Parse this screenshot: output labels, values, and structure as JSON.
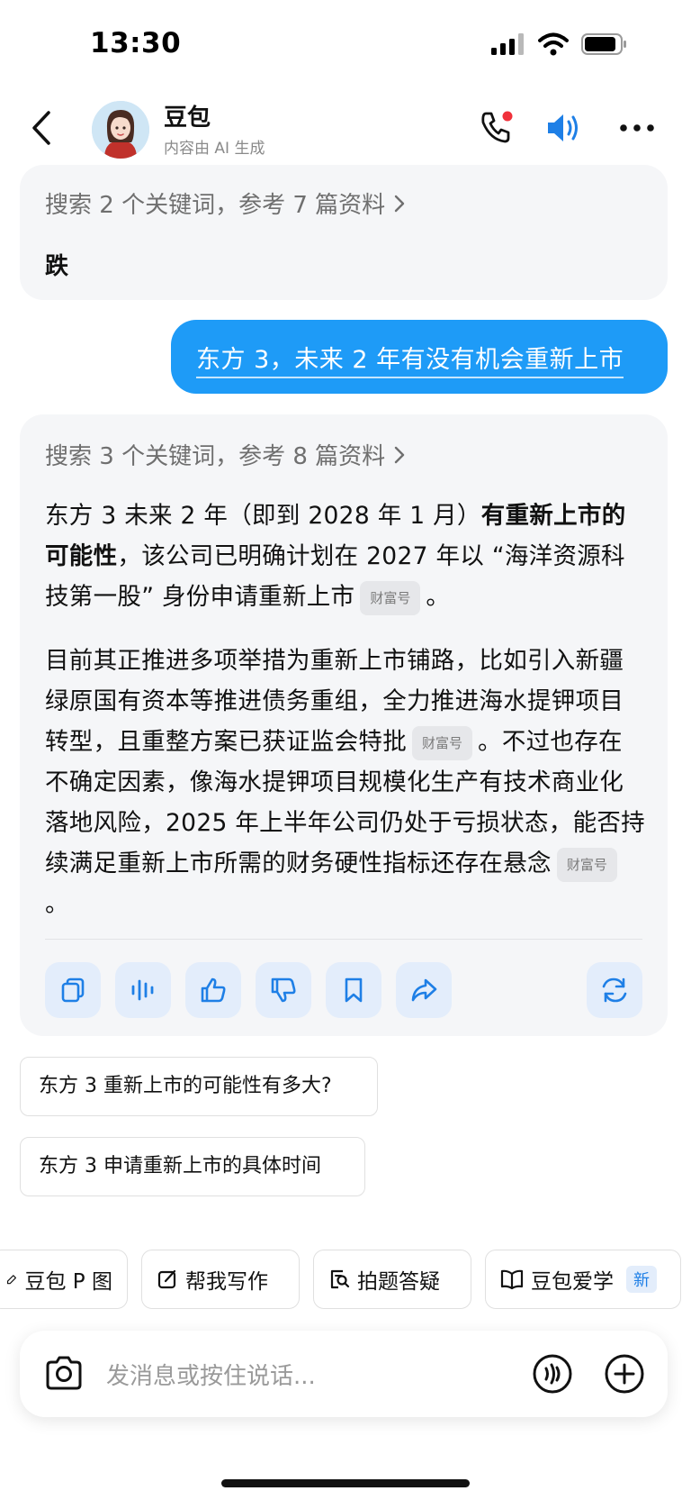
{
  "status_bar": {
    "time": "13:30"
  },
  "header": {
    "bot_name": "豆包",
    "bot_subtitle": "内容由 AI 生成"
  },
  "first_card": {
    "search_text": "搜索 2 个关键词，参考 7 篇资料",
    "short_reply": "跌"
  },
  "user_message": "东方 3，未来 2 年有没有机会重新上市",
  "answer": {
    "search_text": "搜索 3 个关键词，参考 8 篇资料",
    "p1_a": "东方 3 未来 2 年（即到 2028 年 1 月）",
    "p1_bold": "有重新上市的可能性",
    "p1_b": "，该公司已明确计划在 2027 年以 “海洋资源科技第一股” 身份申请重新上市",
    "p1_end": "。",
    "p2_a": "目前其正推进多项举措为重新上市铺路，比如引入新疆绿原国有资本等推进债务重组，全力推进海水提钾项目转型，且重整方案已获证监会特批",
    "p2_b": "。不过也存在不确定因素，像海水提钾项目规模化生产有技术商业化落地风险，2025 年上半年公司仍处于亏损状态，能否持续满足重新上市所需的财务硬性指标还存在悬念",
    "p2_end": "。",
    "source_tag": "财富号"
  },
  "actions": [
    "copy-icon",
    "voice-wave-icon",
    "thumbs-up-icon",
    "thumbs-down-icon",
    "bookmark-icon",
    "share-icon",
    "refresh-icon"
  ],
  "suggestions": [
    "东方 3 重新上市的可能性有多大?",
    "东方 3 申请重新上市的具体时间"
  ],
  "shortcuts": {
    "c1": "豆包 P 图",
    "c2": "帮我写作",
    "c3": "拍题答疑",
    "c4": "豆包爱学",
    "c4_badge": "新"
  },
  "input": {
    "placeholder": "发消息或按住说话..."
  },
  "colors": {
    "accent": "#1e9bf7",
    "action_bg": "#e3edfb",
    "card_bg": "#f5f6f8"
  }
}
